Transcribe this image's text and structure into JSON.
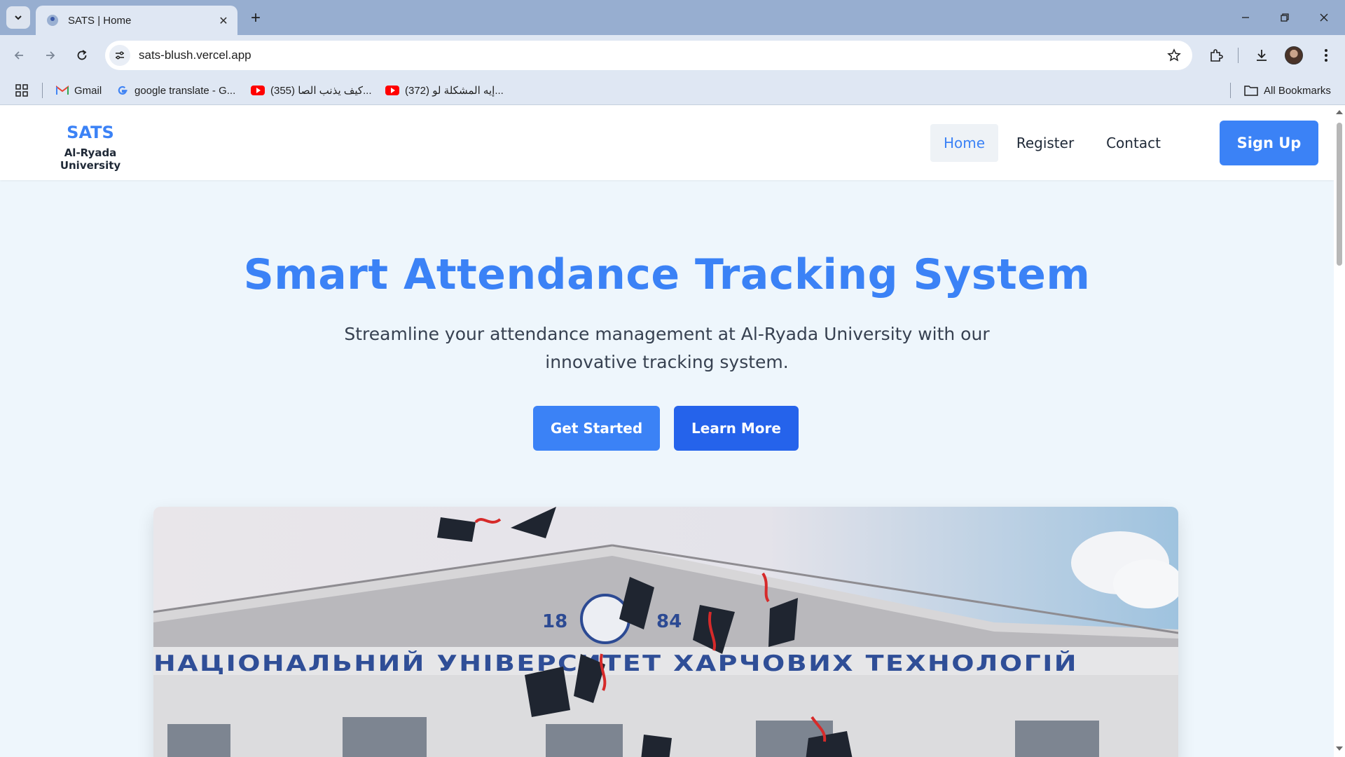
{
  "browser": {
    "tab_title": "SATS | Home",
    "url": "sats-blush.vercel.app",
    "bookmarks": [
      {
        "label": "Gmail",
        "icon": "gmail-icon"
      },
      {
        "label": "google translate - G...",
        "icon": "google-icon"
      },
      {
        "label": "(355) كيف يذنب الصا...",
        "icon": "youtube-icon"
      },
      {
        "label": "(372) إيه المشكلة لو...",
        "icon": "youtube-icon"
      }
    ],
    "all_bookmarks_label": "All Bookmarks"
  },
  "site": {
    "brand": {
      "name": "SATS",
      "subtitle": "Al-Ryada University"
    },
    "nav": [
      {
        "label": "Home",
        "active": true
      },
      {
        "label": "Register",
        "active": false
      },
      {
        "label": "Contact",
        "active": false
      }
    ],
    "signup_label": "Sign Up",
    "hero": {
      "title": "Smart Attendance Tracking System",
      "subtitle": "Streamline your attendance management at Al-Ryada University with our innovative tracking system.",
      "primary_button": "Get Started",
      "secondary_button": "Learn More",
      "image_inscription": "НАЦІОНАЛЬНИЙ УНІВЕРСИТЕТ ХАРЧОВИХ ТЕХНОЛОГІЙ",
      "image_digits_left": "18",
      "image_digits_right": "84"
    }
  },
  "colors": {
    "accent": "#3b82f6",
    "accent_dark": "#2563eb",
    "page_bg": "#eef6fc",
    "browser_frame": "#97aed0",
    "toolbar": "#dfe7f3"
  }
}
